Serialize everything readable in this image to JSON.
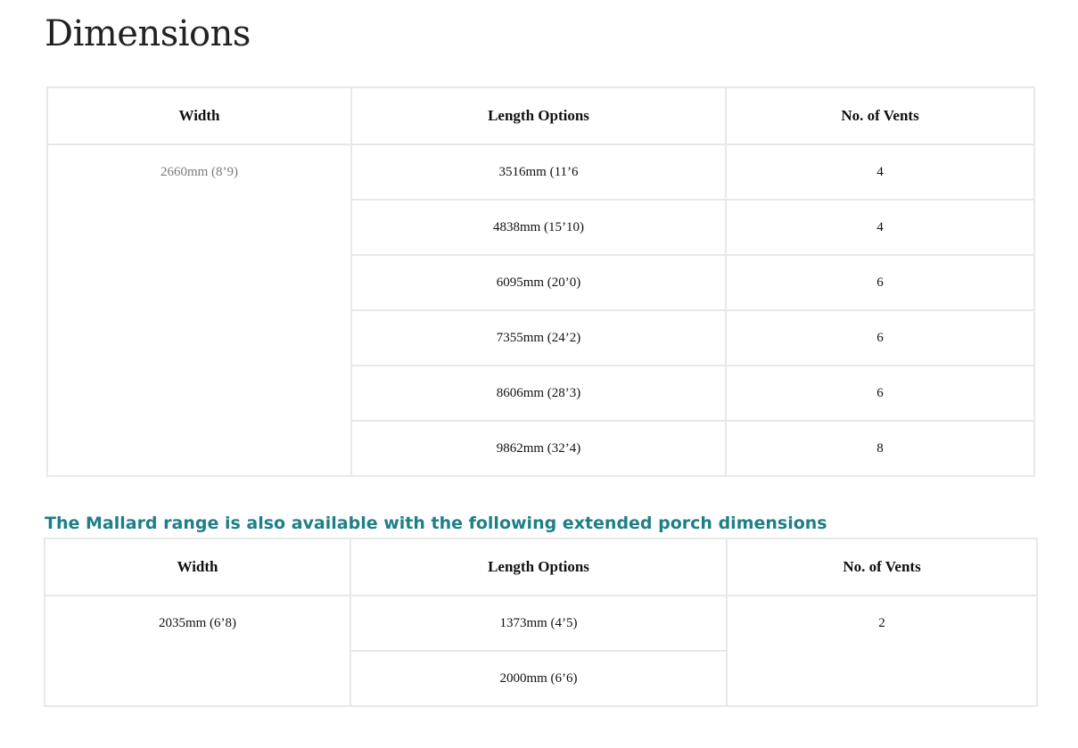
{
  "page": {
    "title": "Dimensions"
  },
  "main_table": {
    "headers": [
      "Width",
      "Length Options",
      "No. of Vents"
    ],
    "width": "2660mm (8’9)",
    "rows": [
      {
        "length": "3516mm (11’6",
        "vents": "4"
      },
      {
        "length": "4838mm (15’10)",
        "vents": "4"
      },
      {
        "length": "6095mm (20’0)",
        "vents": "6"
      },
      {
        "length": "7355mm (24’2)",
        "vents": "6"
      },
      {
        "length": "8606mm (28’3)",
        "vents": "6"
      },
      {
        "length": "9862mm (32’4)",
        "vents": "8"
      }
    ]
  },
  "porch_section": {
    "heading": "The Mallard range is also available with the following extended porch dimensions",
    "accent_color": "#1f7f86"
  },
  "porch_table": {
    "headers": [
      "Width",
      "Length Options",
      "No. of Vents"
    ],
    "width": "2035mm (6’8)",
    "vents": "2",
    "rows": [
      {
        "length": "1373mm (4’5)"
      },
      {
        "length": "2000mm (6’6)"
      }
    ]
  }
}
